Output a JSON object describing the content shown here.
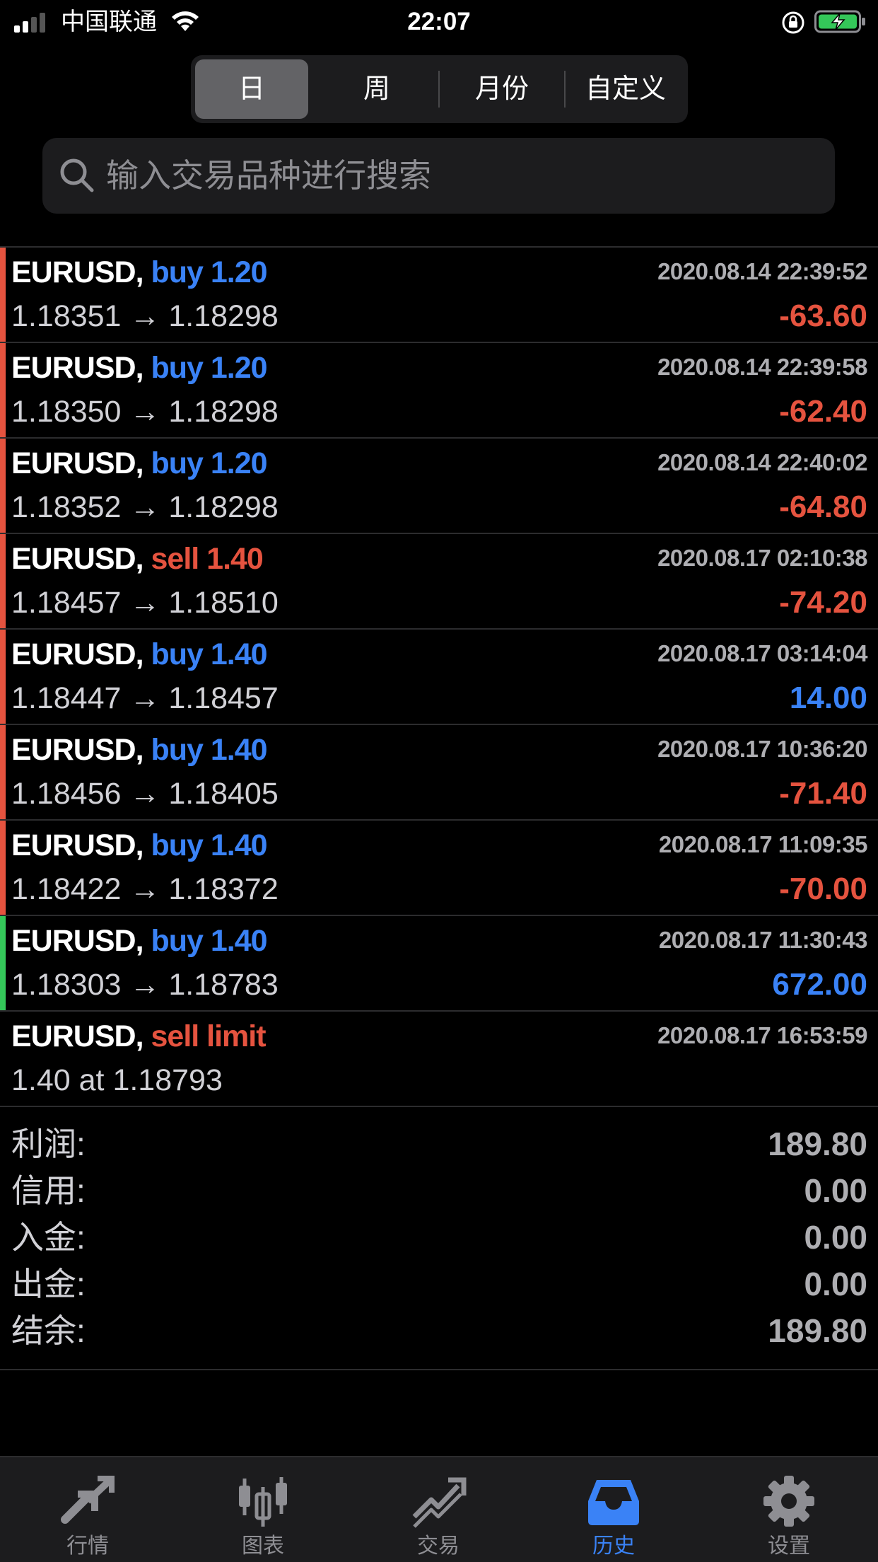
{
  "status_bar": {
    "carrier": "中国联通",
    "time": "22:07"
  },
  "period_tabs": [
    {
      "label": "日",
      "active": true
    },
    {
      "label": "周",
      "active": false
    },
    {
      "label": "月份",
      "active": false
    },
    {
      "label": "自定义",
      "active": false
    }
  ],
  "search": {
    "placeholder": "输入交易品种进行搜索",
    "icon": "search-icon"
  },
  "colors": {
    "loss": "#e5533f",
    "gain": "#3a82f6",
    "buy": "#3a82f6",
    "sell": "#e5533f",
    "green_bar": "#34c759",
    "active_tab": "#3a82f6"
  },
  "trades": [
    {
      "symbol": "EURUSD,",
      "action": "buy 1.20",
      "side": "buy",
      "datetime": "2020.08.14 22:39:52",
      "prices": "1.18351 → 1.18298",
      "profit": "-63.60",
      "bar": "red"
    },
    {
      "symbol": "EURUSD,",
      "action": "buy 1.20",
      "side": "buy",
      "datetime": "2020.08.14 22:39:58",
      "prices": "1.18350 → 1.18298",
      "profit": "-62.40",
      "bar": "red"
    },
    {
      "symbol": "EURUSD,",
      "action": "buy 1.20",
      "side": "buy",
      "datetime": "2020.08.14 22:40:02",
      "prices": "1.18352 → 1.18298",
      "profit": "-64.80",
      "bar": "red"
    },
    {
      "symbol": "EURUSD,",
      "action": "sell 1.40",
      "side": "sell",
      "datetime": "2020.08.17 02:10:38",
      "prices": "1.18457 → 1.18510",
      "profit": "-74.20",
      "bar": "red"
    },
    {
      "symbol": "EURUSD,",
      "action": "buy 1.40",
      "side": "buy",
      "datetime": "2020.08.17 03:14:04",
      "prices": "1.18447 → 1.18457",
      "profit": "14.00",
      "bar": "red"
    },
    {
      "symbol": "EURUSD,",
      "action": "buy 1.40",
      "side": "buy",
      "datetime": "2020.08.17 10:36:20",
      "prices": "1.18456 → 1.18405",
      "profit": "-71.40",
      "bar": "red"
    },
    {
      "symbol": "EURUSD,",
      "action": "buy 1.40",
      "side": "buy",
      "datetime": "2020.08.17 11:09:35",
      "prices": "1.18422 → 1.18372",
      "profit": "-70.00",
      "bar": "red"
    },
    {
      "symbol": "EURUSD,",
      "action": "buy 1.40",
      "side": "buy",
      "datetime": "2020.08.17 11:30:43",
      "prices": "1.18303 → 1.18783",
      "profit": "672.00",
      "bar": "green"
    },
    {
      "symbol": "EURUSD,",
      "action": "sell limit",
      "side": "sell",
      "datetime": "2020.08.17 16:53:59",
      "prices": "1.40 at 1.18793",
      "profit": "",
      "bar": "none"
    }
  ],
  "summary": [
    {
      "label": "利润:",
      "value": "189.80"
    },
    {
      "label": "信用:",
      "value": "0.00"
    },
    {
      "label": "入金:",
      "value": "0.00"
    },
    {
      "label": "出金:",
      "value": "0.00"
    },
    {
      "label": "结余:",
      "value": "189.80"
    }
  ],
  "tab_bar": [
    {
      "label": "行情",
      "icon": "quotes-arrows-icon",
      "active": false
    },
    {
      "label": "图表",
      "icon": "candlestick-chart-icon",
      "active": false
    },
    {
      "label": "交易",
      "icon": "trade-trend-icon",
      "active": false
    },
    {
      "label": "历史",
      "icon": "history-inbox-icon",
      "active": true
    },
    {
      "label": "设置",
      "icon": "settings-gear-icon",
      "active": false
    }
  ]
}
